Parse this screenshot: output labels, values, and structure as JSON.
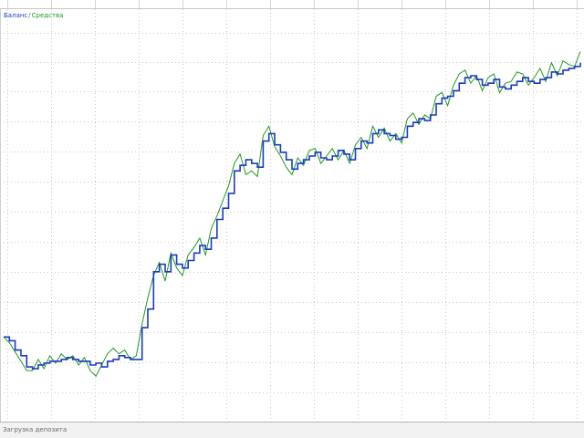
{
  "legend": {
    "balance_label": "Баланс",
    "separator": "/",
    "equity_label": "Средства"
  },
  "status": {
    "text": "Загрузка депозита"
  },
  "colors": {
    "balance": "#1a3bbf",
    "equity": "#1f9a1f",
    "grid": "#c9c9c9",
    "background": "#ffffff"
  },
  "chart_data": {
    "type": "line",
    "grid": true,
    "legend_placement": "top-left",
    "xlabel": "",
    "ylabel": "",
    "ylim": [
      0,
      100
    ],
    "series": [
      {
        "name": "Баланс",
        "x": [
          0,
          1,
          2,
          3,
          4,
          5,
          6,
          7,
          8,
          9,
          10,
          11,
          12,
          13,
          14,
          15,
          16,
          17,
          18,
          19,
          20,
          21,
          22,
          23,
          24,
          25,
          26,
          27,
          28,
          29,
          30,
          31,
          32,
          33,
          34,
          35,
          36,
          37,
          38,
          39,
          40,
          41,
          42,
          43,
          44,
          45,
          46,
          47,
          48,
          49,
          50,
          51,
          52,
          53,
          54,
          55,
          56,
          57,
          58,
          59,
          60,
          61,
          62,
          63,
          64,
          65,
          66,
          67,
          68,
          69,
          70,
          71,
          72,
          73,
          74,
          75,
          76,
          77,
          78,
          79,
          80,
          81,
          82,
          83,
          84,
          85,
          86,
          87,
          88,
          89,
          90,
          91,
          92,
          93,
          94,
          95,
          96,
          97,
          98,
          99,
          100
        ],
        "values": [
          18.5,
          17.5,
          15.0,
          13.5,
          10.5,
          10.0,
          11.0,
          11.5,
          12.0,
          12.0,
          12.5,
          13.0,
          12.5,
          12.0,
          12.0,
          11.0,
          11.5,
          10.5,
          12.0,
          12.5,
          13.5,
          13.0,
          12.5,
          12.5,
          21.0,
          26.0,
          36.0,
          38.0,
          36.0,
          40.5,
          38.0,
          37.0,
          39.0,
          41.0,
          43.0,
          42.0,
          45.0,
          50.0,
          53.0,
          57.0,
          63.0,
          64.5,
          66.0,
          65.0,
          64.0,
          71.0,
          73.0,
          70.0,
          68.0,
          66.0,
          63.5,
          65.0,
          66.0,
          67.0,
          68.0,
          66.5,
          66.0,
          67.0,
          68.5,
          67.5,
          66.0,
          69.0,
          71.0,
          70.5,
          73.0,
          74.0,
          73.0,
          72.5,
          71.5,
          72.0,
          75.0,
          76.0,
          77.0,
          76.5,
          78.0,
          81.0,
          82.5,
          83.0,
          84.5,
          86.5,
          88.0,
          88.5,
          87.5,
          86.0,
          86.5,
          87.5,
          85.5,
          85.0,
          86.0,
          87.0,
          88.0,
          87.0,
          86.5,
          87.5,
          88.0,
          89.5,
          89.0,
          90.0,
          90.5,
          91.0,
          92.0
        ]
      },
      {
        "name": "Средства",
        "x": [
          0,
          1,
          2,
          3,
          4,
          5,
          6,
          7,
          8,
          9,
          10,
          11,
          12,
          13,
          14,
          15,
          16,
          17,
          18,
          19,
          20,
          21,
          22,
          23,
          24,
          25,
          26,
          27,
          28,
          29,
          30,
          31,
          32,
          33,
          34,
          35,
          36,
          37,
          38,
          39,
          40,
          41,
          42,
          43,
          44,
          45,
          46,
          47,
          48,
          49,
          50,
          51,
          52,
          53,
          54,
          55,
          56,
          57,
          58,
          59,
          60,
          61,
          62,
          63,
          64,
          65,
          66,
          67,
          68,
          69,
          70,
          71,
          72,
          73,
          74,
          75,
          76,
          77,
          78,
          79,
          80,
          81,
          82,
          83,
          84,
          85,
          86,
          87,
          88,
          89,
          90,
          91,
          92,
          93,
          94,
          95,
          96,
          97,
          98,
          99,
          100
        ],
        "values": [
          18.5,
          17.0,
          14.5,
          12.0,
          9.5,
          9.5,
          12.5,
          10.0,
          13.5,
          11.5,
          14.0,
          12.5,
          13.5,
          11.0,
          13.0,
          9.5,
          8.0,
          11.0,
          14.0,
          15.5,
          14.0,
          15.0,
          12.5,
          13.5,
          22.0,
          29.0,
          35.0,
          38.5,
          33.5,
          41.0,
          37.0,
          35.0,
          40.5,
          42.5,
          45.0,
          40.5,
          47.5,
          51.0,
          55.0,
          59.0,
          65.0,
          67.5,
          62.0,
          63.0,
          61.5,
          72.5,
          75.0,
          69.5,
          67.0,
          64.0,
          62.0,
          66.5,
          64.5,
          68.5,
          69.0,
          65.0,
          67.0,
          69.0,
          66.0,
          68.5,
          65.0,
          70.0,
          72.0,
          69.0,
          75.0,
          72.0,
          74.5,
          71.0,
          73.0,
          70.5,
          77.0,
          78.5,
          75.5,
          78.0,
          77.0,
          83.0,
          84.0,
          80.5,
          86.0,
          89.0,
          90.0,
          86.5,
          88.5,
          84.5,
          88.0,
          89.0,
          84.0,
          86.5,
          87.0,
          89.5,
          89.0,
          86.0,
          88.0,
          90.5,
          87.0,
          92.0,
          88.5,
          92.5,
          91.5,
          91.0,
          95.0
        ]
      }
    ]
  }
}
